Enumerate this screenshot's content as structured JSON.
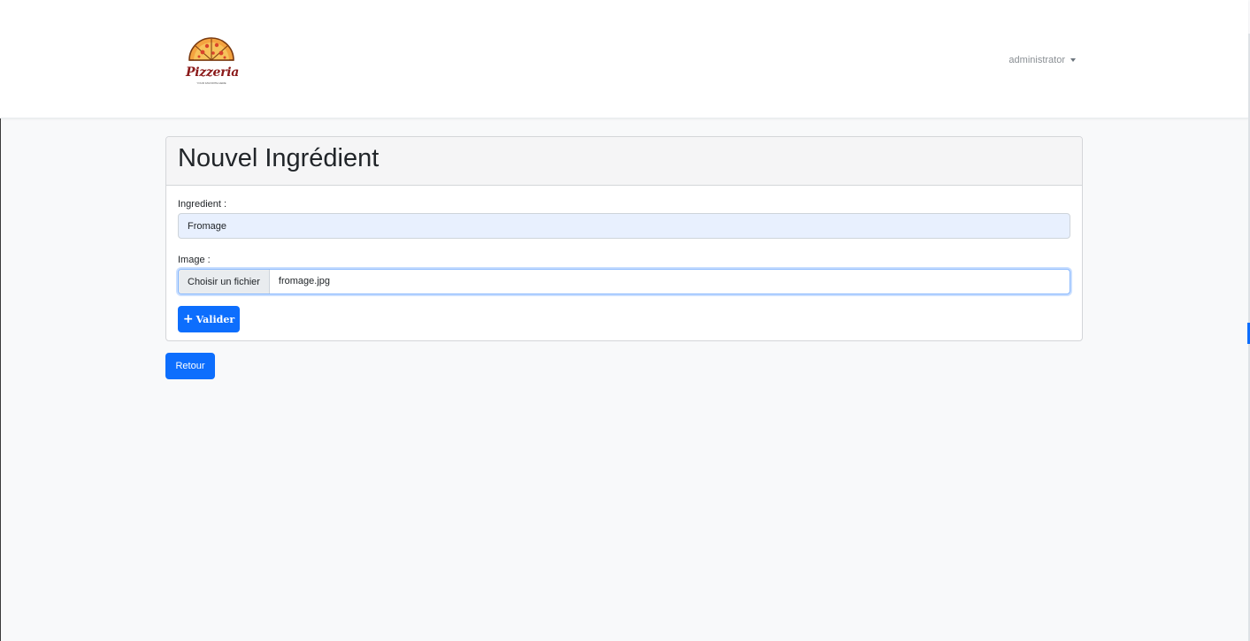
{
  "brand": {
    "logo_icon": "pizza-slice-icon",
    "name": "Pizzeria",
    "tagline": "YOUR FAVORITE HERE"
  },
  "navbar": {
    "user_label": "administrator"
  },
  "card": {
    "title": "Nouvel Ingrédient"
  },
  "form": {
    "ingredient_label": "Ingredient :",
    "ingredient_value": "Fromage",
    "image_label": "Image :",
    "file_button_label": "Choisir un fichier",
    "file_name": "fromage.jpg",
    "submit_label": "Valider",
    "submit_icon": "plus-icon"
  },
  "actions": {
    "back_label": "Retour"
  },
  "colors": {
    "primary": "#0d6efd",
    "page_background": "#f8f9fa",
    "logo_text": "#8b1a1a",
    "pizza_crust": "#f4a340",
    "pizza_topping": "#d9442b"
  }
}
